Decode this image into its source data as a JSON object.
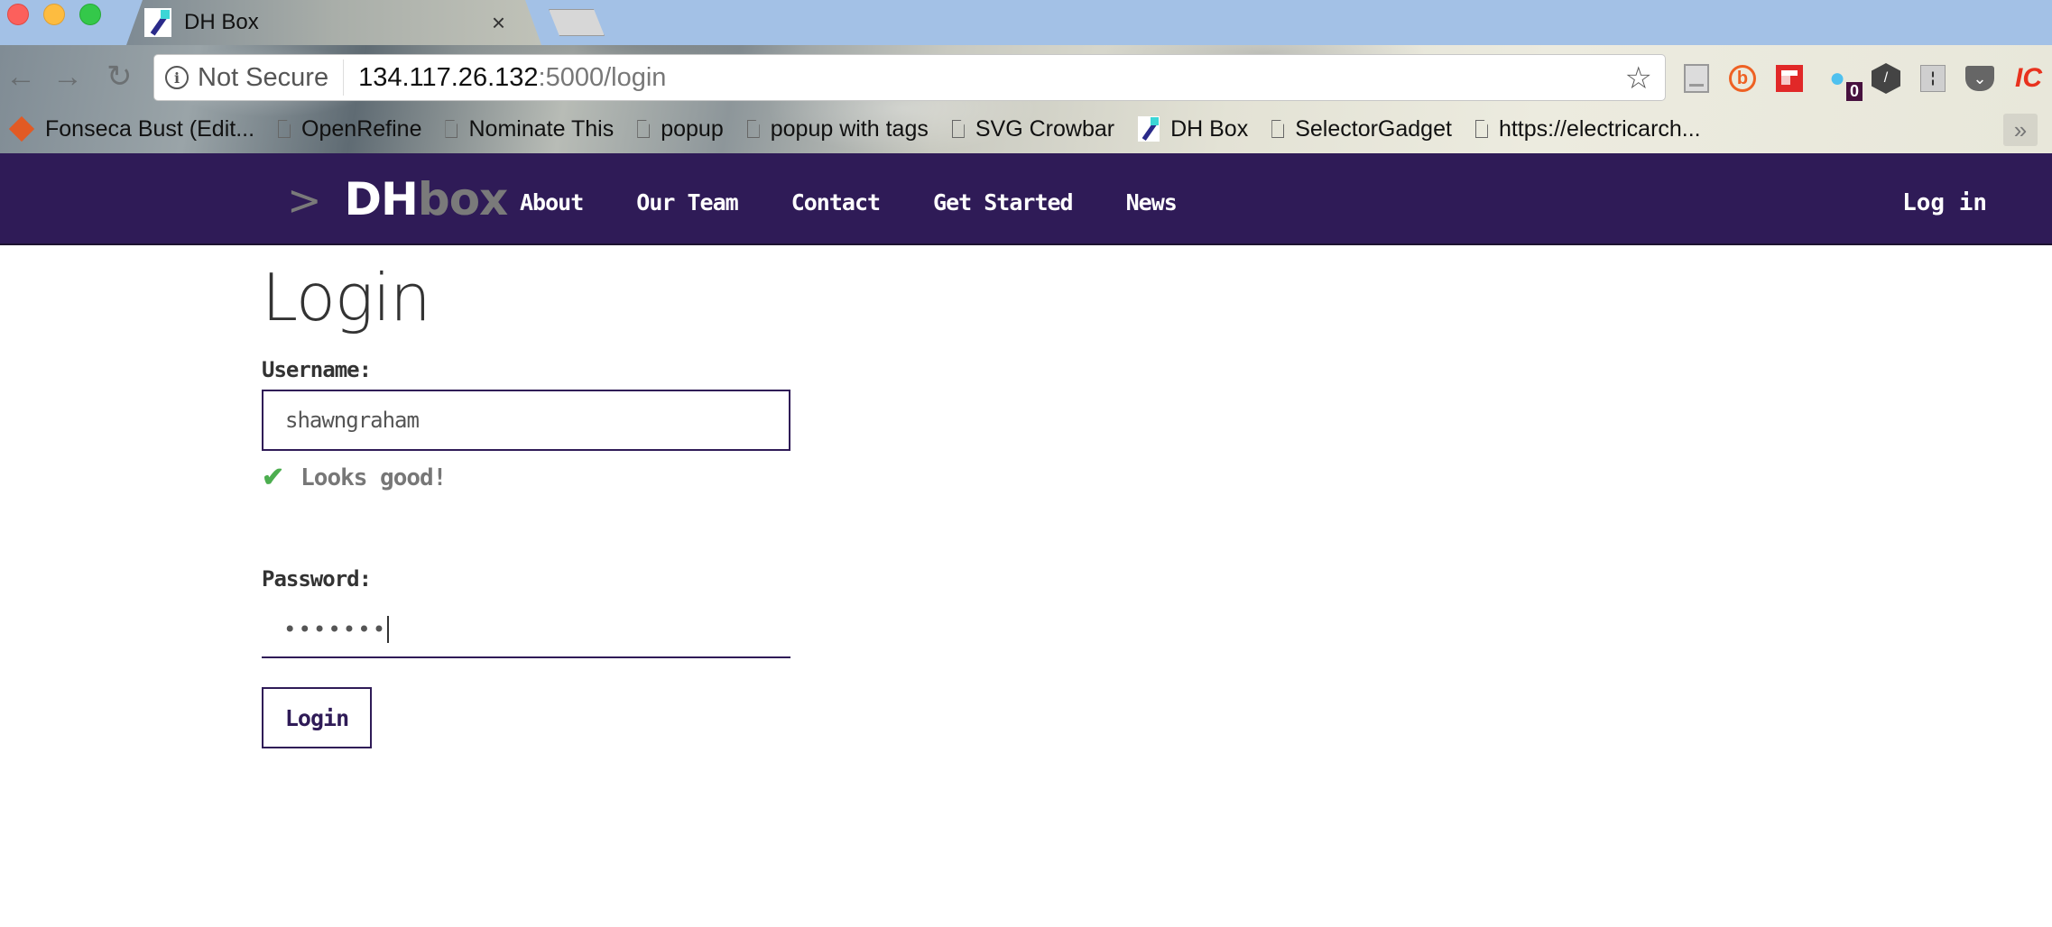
{
  "browser": {
    "tab": {
      "title": "DH Box",
      "close_glyph": "×"
    },
    "omnibox": {
      "security_label": "Not Secure",
      "url_host": "134.117.26.132",
      "url_rest": ":5000/login"
    },
    "nav_glyphs": {
      "back": "←",
      "forward": "→",
      "reload": "↻",
      "star": "☆"
    },
    "extensions": {
      "bitly_glyph": "b",
      "ghostery_glyph": "👻",
      "ghostery_badge": "0",
      "hex_glyph": "/",
      "outlet_glyph": "¦",
      "pocket_glyph": "⌄",
      "partial_glyph": "IC"
    },
    "bookmarks": [
      {
        "label": "Fonseca Bust (Edit...",
        "icon": "diamond-icon"
      },
      {
        "label": "OpenRefine",
        "icon": "page-icon"
      },
      {
        "label": "Nominate This",
        "icon": "page-icon"
      },
      {
        "label": "popup",
        "icon": "page-icon"
      },
      {
        "label": "popup with tags",
        "icon": "page-icon"
      },
      {
        "label": "SVG Crowbar",
        "icon": "page-icon"
      },
      {
        "label": "DH Box",
        "icon": "dhbox-favicon"
      },
      {
        "label": "SelectorGadget",
        "icon": "page-icon"
      },
      {
        "label": "https://electricarch...",
        "icon": "page-icon"
      }
    ],
    "bookmarks_more": "»"
  },
  "site": {
    "logo": {
      "caret": ">",
      "dh": "DH",
      "box": "box"
    },
    "nav": [
      "About",
      "Our Team",
      "Contact",
      "Get Started",
      "News"
    ],
    "login_link": "Log in",
    "colors": {
      "nav_bg": "#2f1b57",
      "valid_green": "#4cae4f"
    }
  },
  "login_form": {
    "title": "Login",
    "username_label": "Username:",
    "username_value": "shawngraham",
    "valid_check": "✔",
    "valid_message": "Looks good!",
    "password_label": "Password:",
    "password_masked": "•••••••",
    "submit_label": "Login"
  }
}
